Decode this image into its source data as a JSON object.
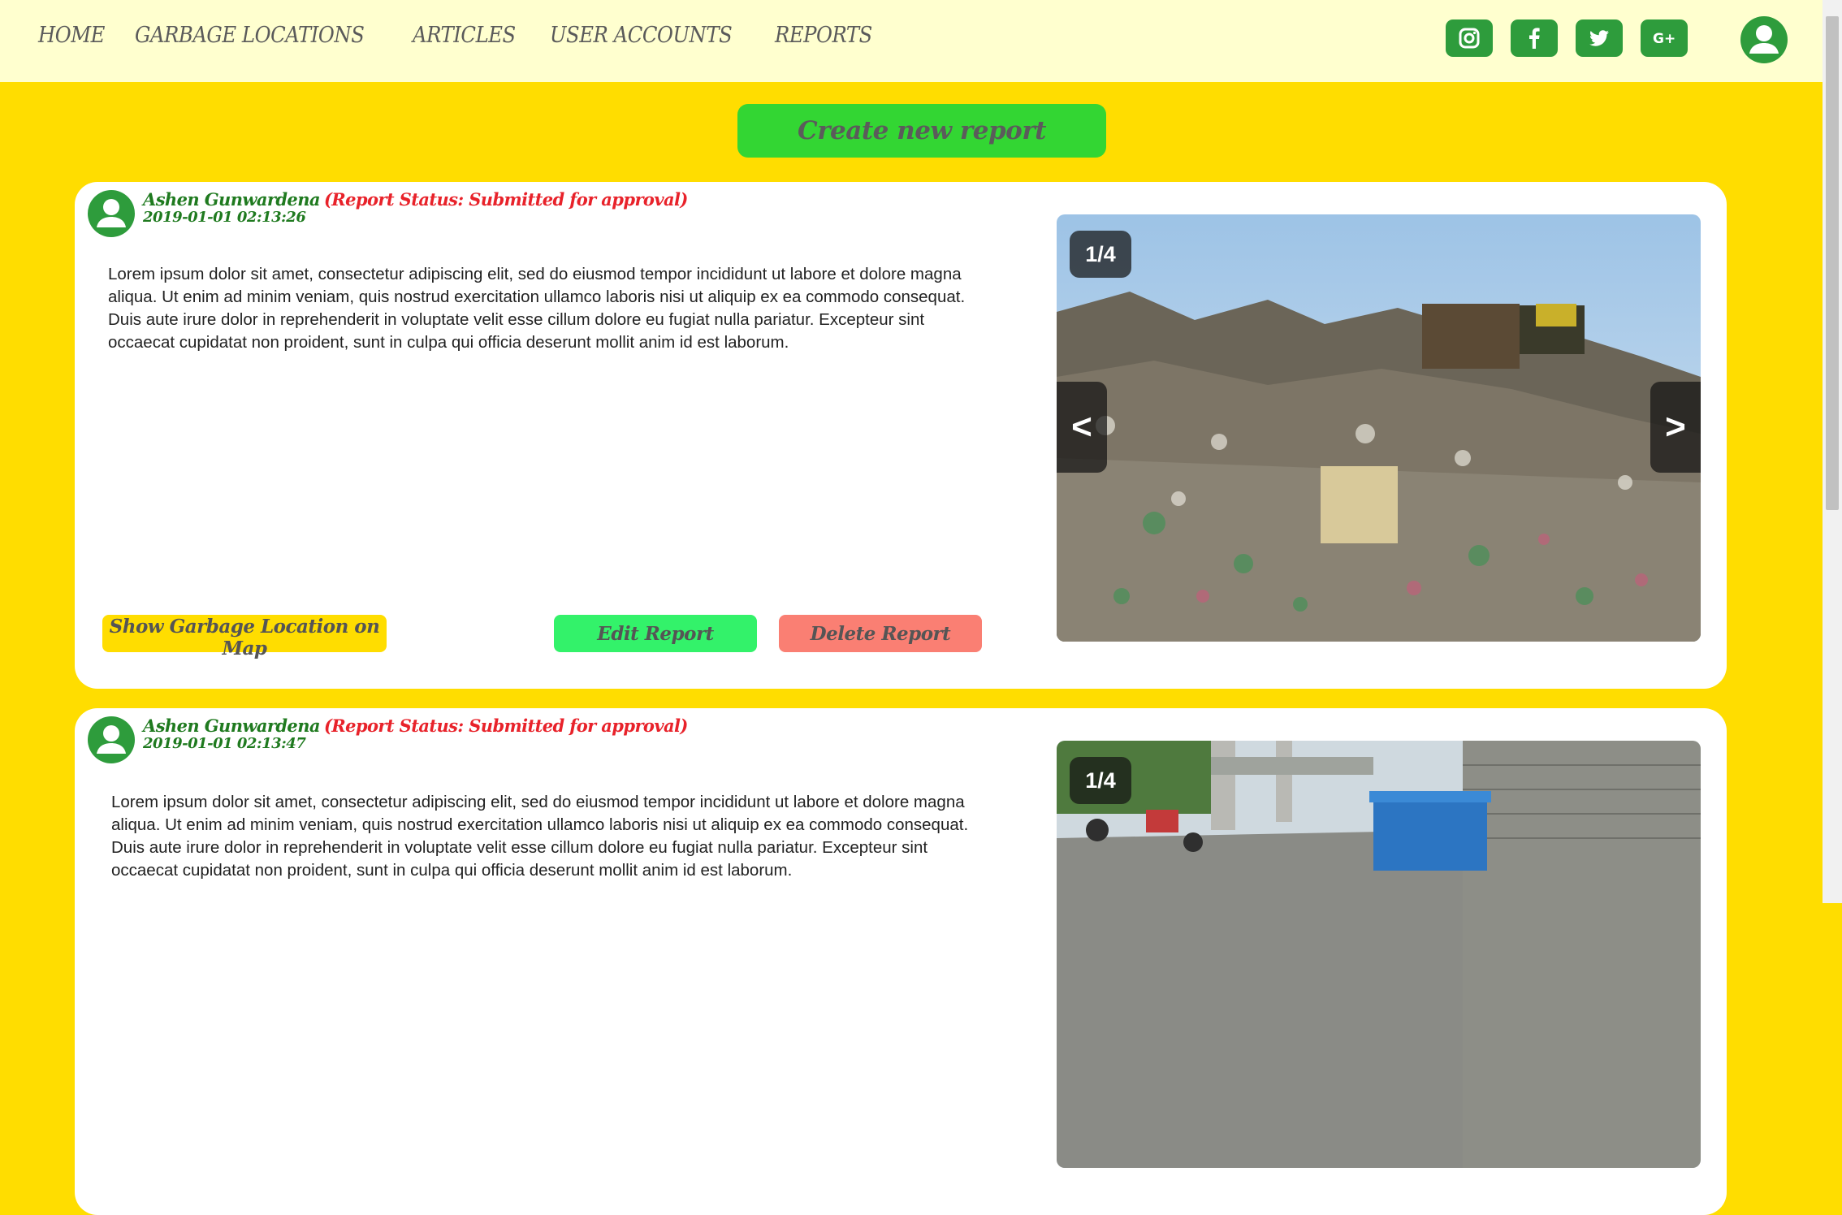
{
  "nav": {
    "items": [
      "HOME",
      "GARBAGE LOCATIONS",
      "ARTICLES",
      "USER ACCOUNTS",
      "REPORTS"
    ]
  },
  "social": [
    "instagram-icon",
    "facebook-icon",
    "twitter-icon",
    "google-plus-icon"
  ],
  "create_button": "Create new report",
  "colors": {
    "page_bg": "#ffdd00",
    "nav_bg": "#ffffcf",
    "brand_green": "#2e9c3c",
    "create_button": "#33d633",
    "author": "#1f7a1f",
    "status": "#e8222a",
    "map_button": "#ffdd00",
    "edit_button": "#33f26a",
    "delete_button": "#fa7f73"
  },
  "reports": [
    {
      "author": "Ashen Gunwardena",
      "status": "(Report Status: Submitted for approval)",
      "date": "2019-01-01 02:13:26",
      "body": "Lorem ipsum dolor sit amet, consectetur adipiscing elit, sed do eiusmod tempor incididunt ut labore et dolore magna aliqua. Ut enim ad minim veniam, quis nostrud exercitation ullamco laboris nisi ut aliquip ex ea commodo consequat. Duis aute irure dolor in reprehenderit in voluptate velit esse cillum dolore eu fugiat nulla pariatur. Excepteur sint occaecat cupidatat non proident, sunt in culpa qui officia deserunt mollit anim id est laborum.",
      "map_button": "Show Garbage Location on Map",
      "edit_button": "Edit Report",
      "delete_button": "Delete Report",
      "image_counter": "1/4",
      "prev": "<",
      "next": ">"
    },
    {
      "author": "Ashen Gunwardena",
      "status": "(Report Status: Submitted for approval)",
      "date": "2019-01-01 02:13:47",
      "body": "Lorem ipsum dolor sit amet, consectetur adipiscing elit, sed do eiusmod tempor incididunt ut labore et dolore magna aliqua. Ut enim ad minim veniam, quis nostrud exercitation ullamco laboris nisi ut aliquip ex ea commodo consequat. Duis aute irure dolor in reprehenderit in voluptate velit esse cillum dolore eu fugiat nulla pariatur. Excepteur sint occaecat cupidatat non proident, sunt in culpa qui officia deserunt mollit anim id est laborum.",
      "image_counter": "1/4"
    }
  ]
}
